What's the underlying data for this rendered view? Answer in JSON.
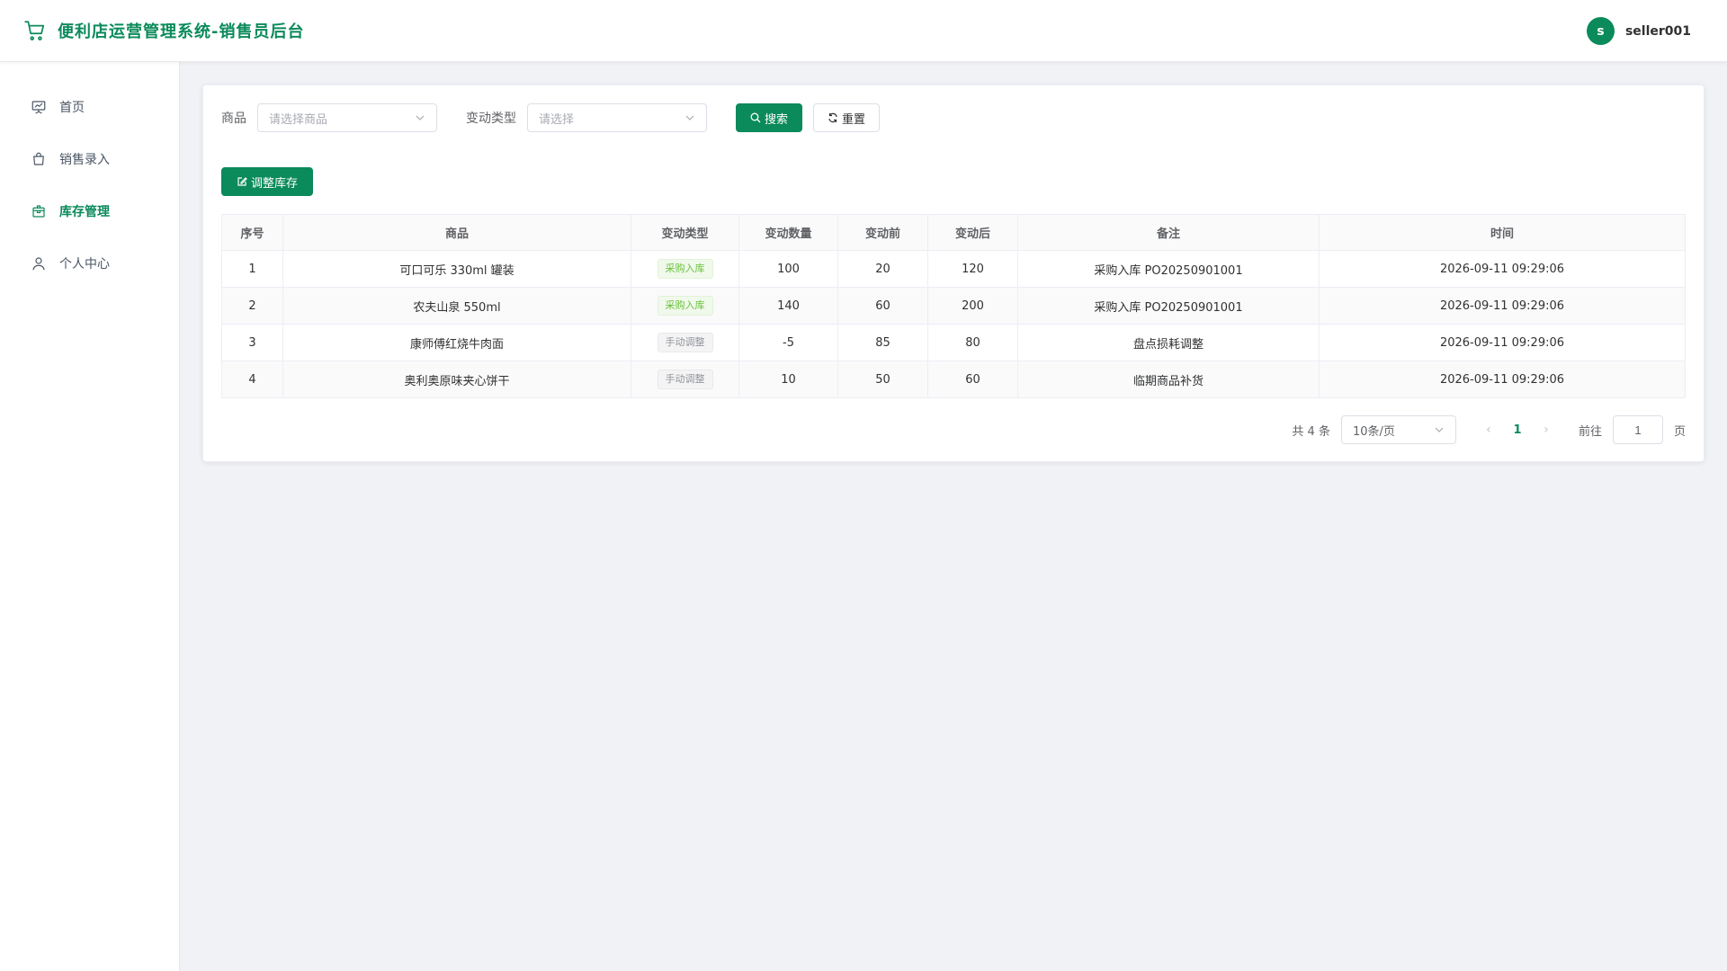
{
  "header": {
    "title": "便利店运营管理系统-销售员后台",
    "avatar_letter": "s",
    "username": "seller001"
  },
  "sidebar": {
    "items": [
      {
        "label": "首页",
        "icon": "presentation-icon"
      },
      {
        "label": "销售录入",
        "icon": "shopping-bag-icon"
      },
      {
        "label": "库存管理",
        "icon": "box-icon",
        "active": true
      },
      {
        "label": "个人中心",
        "icon": "user-icon"
      }
    ]
  },
  "filters": {
    "product_label": "商品",
    "product_placeholder": "请选择商品",
    "type_label": "变动类型",
    "type_placeholder": "请选择",
    "search_label": "搜索",
    "reset_label": "重置"
  },
  "toolbar": {
    "adjust_label": "调整库存"
  },
  "table": {
    "columns": [
      "序号",
      "商品",
      "变动类型",
      "变动数量",
      "变动前",
      "变动后",
      "备注",
      "时间"
    ],
    "rows": [
      {
        "index": "1",
        "product": "可口可乐 330ml 罐装",
        "type": "采购入库",
        "qty": "100",
        "before": "20",
        "after": "120",
        "note": "采购入库 PO20250901001",
        "time": "2026-09-11 09:29:06"
      },
      {
        "index": "2",
        "product": "农夫山泉 550ml",
        "type": "采购入库",
        "qty": "140",
        "before": "60",
        "after": "200",
        "note": "采购入库 PO20250901001",
        "time": "2026-09-11 09:29:06"
      },
      {
        "index": "3",
        "product": "康师傅红烧牛肉面",
        "type": "手动调整",
        "qty": "-5",
        "before": "85",
        "after": "80",
        "note": "盘点损耗调整",
        "time": "2026-09-11 09:29:06"
      },
      {
        "index": "4",
        "product": "奥利奥原味夹心饼干",
        "type": "手动调整",
        "qty": "10",
        "before": "50",
        "after": "60",
        "note": "临期商品补货",
        "time": "2026-09-11 09:29:06"
      }
    ]
  },
  "pagination": {
    "total_text": "共 4 条",
    "page_size": "10条/页",
    "current_page": "1",
    "goto_label": "前往",
    "goto_value": "1",
    "page_suffix": "页"
  },
  "colors": {
    "primary": "#0b8a5b",
    "tag_inbound": "#67c23a",
    "tag_manual": "#909399"
  }
}
